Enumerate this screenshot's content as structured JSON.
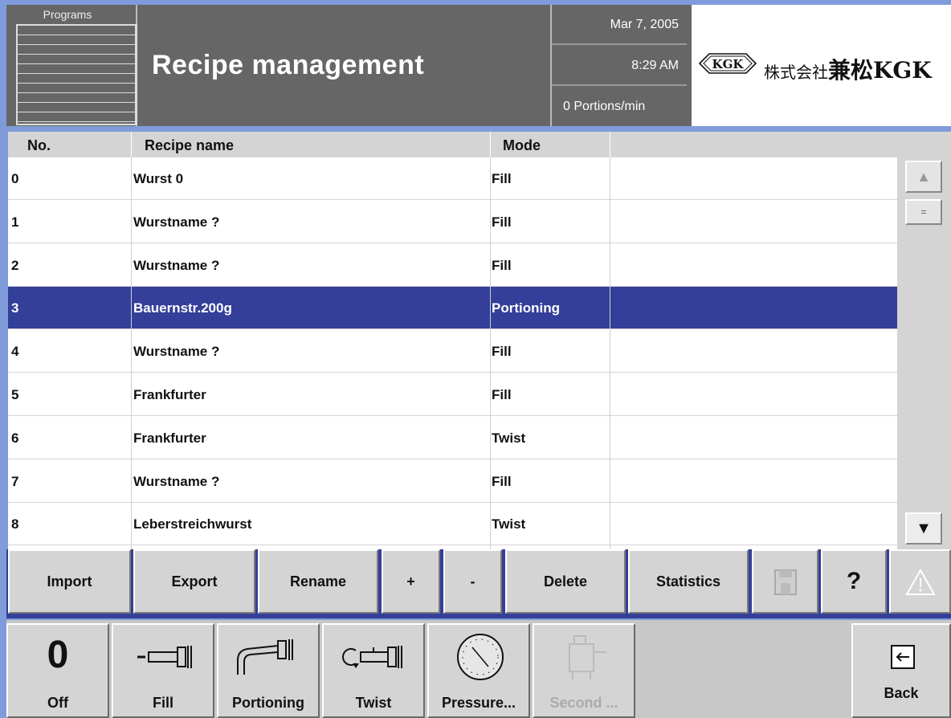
{
  "header": {
    "programs_label": "Programs",
    "title": "Recipe management",
    "date": "Mar 7, 2005",
    "time": "8:29 AM",
    "rate": "0 Portions/min",
    "logo_mark": "KGK",
    "logo_text_small": "株式会社",
    "logo_text_big": "兼松KGK"
  },
  "table": {
    "columns": [
      "No.",
      "Recipe name",
      "Mode"
    ],
    "selected_index": 3,
    "rows": [
      {
        "no": "0",
        "name": "Wurst 0",
        "mode": "Fill"
      },
      {
        "no": "1",
        "name": "Wurstname ?",
        "mode": "Fill"
      },
      {
        "no": "2",
        "name": "Wurstname ?",
        "mode": "Fill"
      },
      {
        "no": "3",
        "name": "Bauernstr.200g",
        "mode": "Portioning"
      },
      {
        "no": "4",
        "name": "Wurstname ?",
        "mode": "Fill"
      },
      {
        "no": "5",
        "name": "Frankfurter",
        "mode": "Fill"
      },
      {
        "no": "6",
        "name": "Frankfurter",
        "mode": "Twist"
      },
      {
        "no": "7",
        "name": "Wurstname ?",
        "mode": "Fill"
      },
      {
        "no": "8",
        "name": "Leberstreichwurst",
        "mode": "Twist"
      }
    ]
  },
  "scrollbar": {
    "up_icon": "triangle-up-icon",
    "thumb_glyph": "=",
    "down_icon": "triangle-down-icon"
  },
  "actions": {
    "import": "Import",
    "export": "Export",
    "rename": "Rename",
    "plus": "+",
    "minus": "-",
    "delete": "Delete",
    "statistics": "Statistics",
    "save_icon": "floppy-disk-icon",
    "help": "?",
    "warning_icon": "warning-triangle-icon"
  },
  "functions": {
    "off_glyph": "0",
    "off": "Off",
    "fill": "Fill",
    "portioning": "Portioning",
    "twist": "Twist",
    "pressure": "Pressure...",
    "second": "Second ...",
    "back": "Back"
  },
  "colors": {
    "selection": "#333f99",
    "header_bg": "#666666",
    "page_bg": "#7f9bd9",
    "button_bg": "#d4d4d4"
  }
}
